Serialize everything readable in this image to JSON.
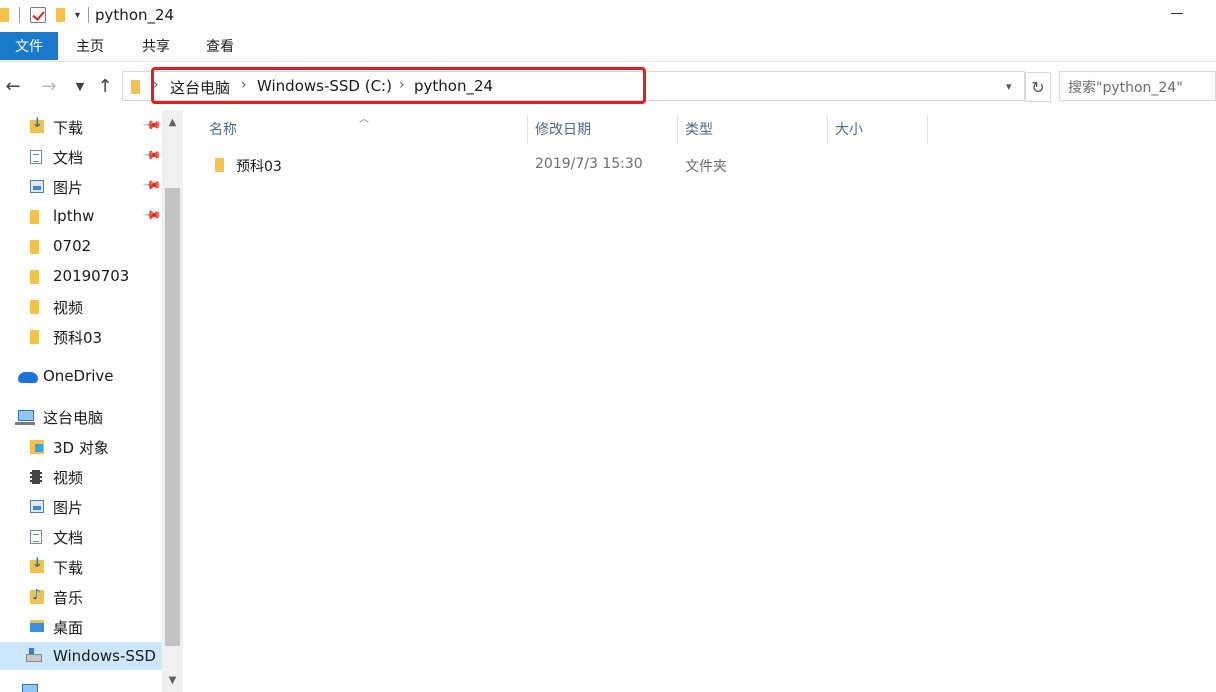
{
  "window": {
    "title": "python_24"
  },
  "ribbon": {
    "tabs": [
      "文件",
      "主页",
      "共享",
      "查看"
    ]
  },
  "address": {
    "crumbs": [
      "这台电脑",
      "Windows-SSD (C:)",
      "python_24"
    ],
    "search_placeholder": "搜索\"python_24\""
  },
  "sidebar": {
    "quick_access": [
      {
        "label": "下载",
        "icon": "download-folder-icon",
        "pinned": true
      },
      {
        "label": "文档",
        "icon": "documents-icon",
        "pinned": true
      },
      {
        "label": "图片",
        "icon": "pictures-icon",
        "pinned": true
      },
      {
        "label": "lpthw",
        "icon": "folder-icon",
        "pinned": true
      },
      {
        "label": "0702",
        "icon": "folder-icon",
        "pinned": false
      },
      {
        "label": "20190703",
        "icon": "folder-icon",
        "pinned": false
      },
      {
        "label": "视频",
        "icon": "folder-icon",
        "pinned": false
      },
      {
        "label": "预科03",
        "icon": "folder-icon",
        "pinned": false
      }
    ],
    "onedrive": "OneDrive",
    "this_pc": "这台电脑",
    "pc_items": [
      {
        "label": "3D 对象",
        "icon": "3d-objects-icon"
      },
      {
        "label": "视频",
        "icon": "videos-icon"
      },
      {
        "label": "图片",
        "icon": "pictures-icon"
      },
      {
        "label": "文档",
        "icon": "documents-icon"
      },
      {
        "label": "下载",
        "icon": "download-folder-icon"
      },
      {
        "label": "音乐",
        "icon": "music-icon"
      },
      {
        "label": "桌面",
        "icon": "desktop-icon"
      },
      {
        "label": "Windows-SSD (",
        "icon": "drive-icon",
        "selected": true
      }
    ]
  },
  "columns": {
    "name": "名称",
    "date": "修改日期",
    "type": "类型",
    "size": "大小"
  },
  "files": [
    {
      "name": "预科03",
      "date": "2019/7/3 15:30",
      "type": "文件夹"
    }
  ]
}
